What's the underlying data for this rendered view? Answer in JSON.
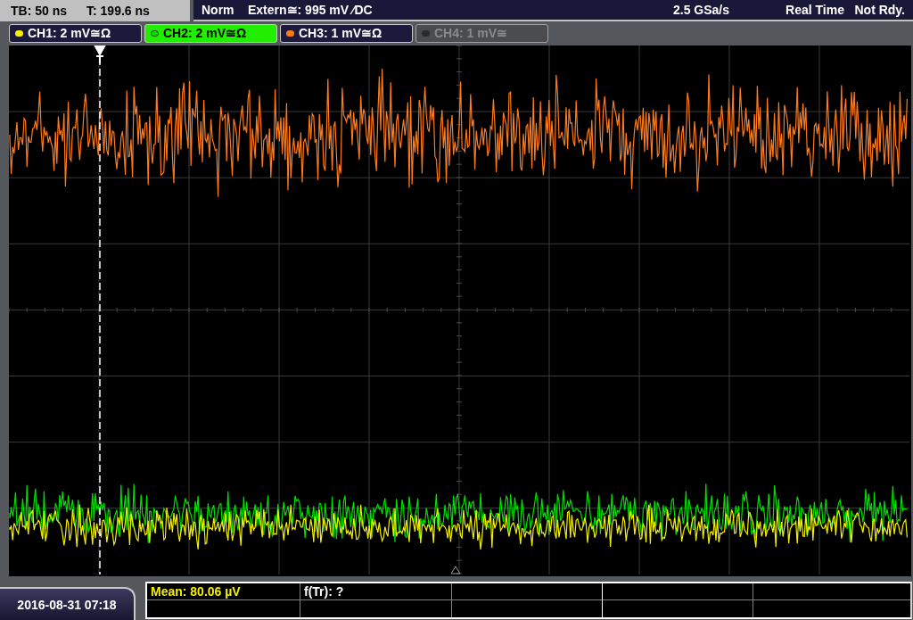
{
  "status_bar": {
    "timebase": "TB: 50 ns",
    "trigger_time": "T: 199.6 ns",
    "trigger_mode": "Norm",
    "trigger_source": "Extern≅: 995 mV ⁄DC",
    "sample_rate": "2.5 GSa/s",
    "acquisition": "Real Time",
    "state": "Not Rdy."
  },
  "channels": [
    {
      "label": "CH1: 2 mV≅Ω",
      "color": "#f5f000",
      "selected": false,
      "enabled": true
    },
    {
      "label": "CH2: 2 mV≅Ω",
      "color": "#00e000",
      "selected": true,
      "enabled": true
    },
    {
      "label": "CH3: 1 mV≅Ω",
      "color": "#ff7a1a",
      "selected": false,
      "enabled": true
    },
    {
      "label": "CH4: 1 mV≅",
      "color": "#2a2a2a",
      "selected": false,
      "enabled": false
    }
  ],
  "date_time": "2016-08-31 07:18",
  "measurements": [
    {
      "label": "Mean: 80.06 µV",
      "color": "#f5f000"
    },
    {
      "label": "f(Tr): ?",
      "color": "#ffffff"
    }
  ]
}
